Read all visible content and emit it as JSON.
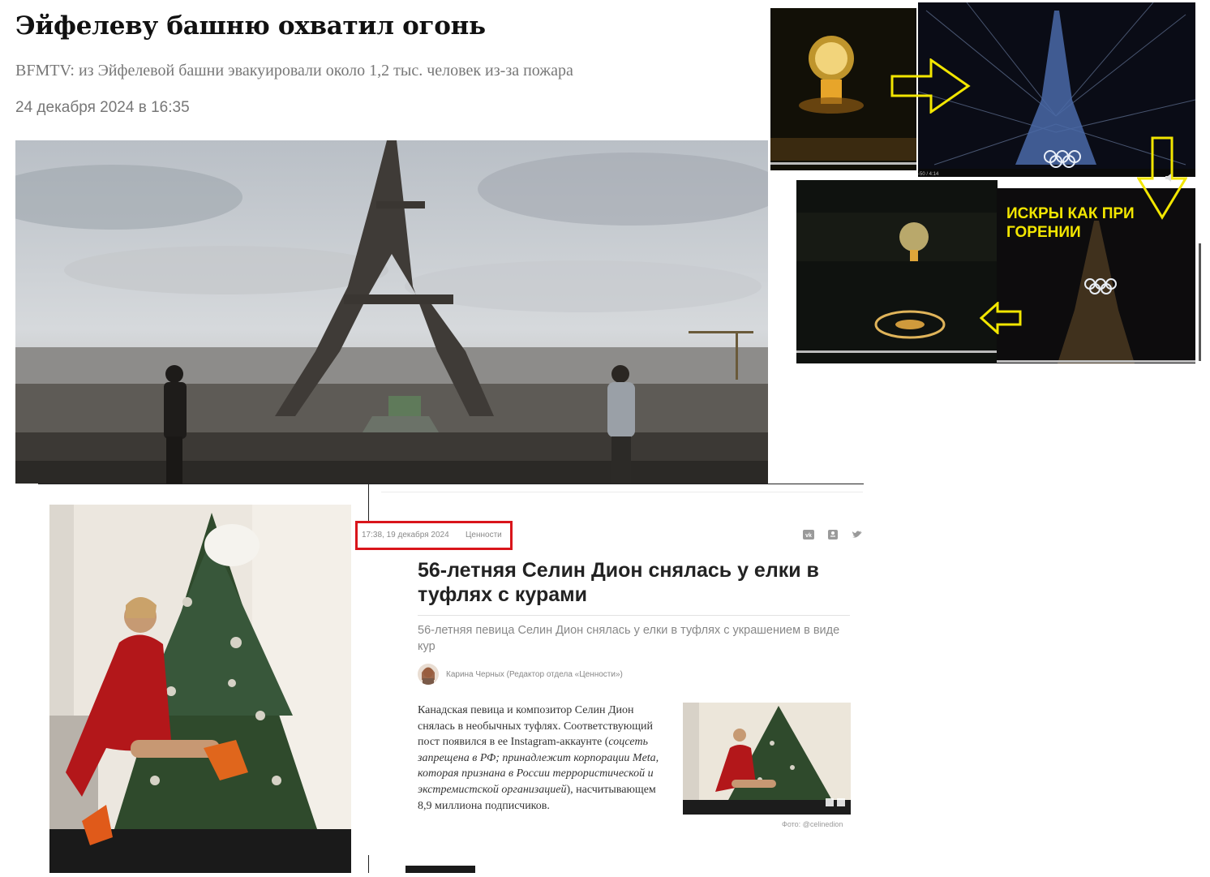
{
  "article1": {
    "title": "Эйфелеву башню охватил огонь",
    "subtitle": "BFMTV: из Эйфелевой башни эвакуировали около 1,2 тыс. человек из-за пожара",
    "date": "24 декабря 2024 в 16:35"
  },
  "collage": {
    "overlay_text_line1": "ИСКРЫ КАК ПРИ",
    "overlay_text_line2": "ГОРЕНИИ",
    "video_time": "-50 / 4:14",
    "arrow_color": "#f2e600"
  },
  "article2": {
    "date": "17:38, 19 декабря 2024",
    "category": "Ценности",
    "share_icons": [
      "vk-icon",
      "ok-icon",
      "twitter-icon"
    ],
    "title": "56-летняя Селин Дион снялась у елки в туфлях с курами",
    "lead": "56-летняя певица Селин Дион снялась у елки в туфлях с украшением в виде кур",
    "author": "Карина Черных (Редактор отдела «Ценности»)",
    "body_part1": "Канадская певица и композитор Селин Дион снялась в необычных туфлях. Соответствующий пост появился в ее Instagram-аккаунте (",
    "body_italic": "соцсеть запрещена в РФ; принадлежит корпорации Meta, которая признана в России террористической и экстремистской организацией",
    "body_part2": "), насчитывающем 8,9 миллиона подписчиков.",
    "photo_caption": "Фото: @celinedion",
    "highlight_color": "#d9151b"
  }
}
